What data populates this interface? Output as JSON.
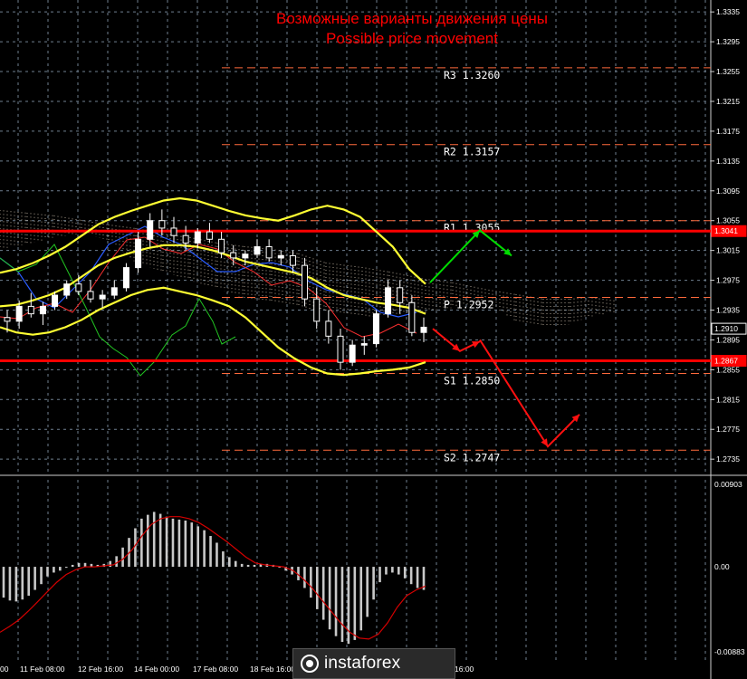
{
  "title_ru": "Возможные варианты движения цены",
  "title_en": "Possible price movement",
  "colors": {
    "background": "#000000",
    "grid": "#6f7f8f",
    "title": "#ff0000",
    "pivot_lines": "#ff6a3c",
    "support_resistance": "#ff0000",
    "bollinger": "#ffff33",
    "candles": "#ffffff",
    "arrow_up": "#00dd00",
    "arrow_down": "#ff1010",
    "macd_hist": "#c8c8c8",
    "macd_signal": "#d40000"
  },
  "chart_data": {
    "type": "candlestick",
    "symbol_direction_note": "",
    "y_axis": {
      "ylim": [
        1.2717,
        1.3351
      ],
      "ticks": [
        "1.3335",
        "1.3295",
        "1.3255",
        "1.3215",
        "1.3175",
        "1.3135",
        "1.3095",
        "1.3055",
        "1.3015",
        "1.2975",
        "1.2935",
        "1.2895",
        "1.2855",
        "1.2815",
        "1.2775",
        "1.2735"
      ],
      "price_labels": [
        {
          "value": 1.3041,
          "text": "1.3041"
        },
        {
          "value": 1.291,
          "text": "1.2910"
        },
        {
          "value": 1.2867,
          "text": "1.2867"
        }
      ]
    },
    "x_axis": {
      "ticks": [
        "00",
        "11 Feb 08:00",
        "12 Feb 16:00",
        "14 Feb 00:00",
        "17 Feb 08:00",
        "18 Feb 16:00",
        "16:00"
      ]
    },
    "pivot_levels": [
      {
        "label": "R3",
        "value": "1.3260"
      },
      {
        "label": "R2",
        "value": "1.3157"
      },
      {
        "label": "R1",
        "value": "1.3055"
      },
      {
        "label": "P",
        "value": "1.2952"
      },
      {
        "label": "S1",
        "value": "1.2850"
      },
      {
        "label": "S2",
        "value": "1.2747"
      }
    ],
    "horizontal_levels": [
      1.3041,
      1.2867
    ],
    "candles_ohlc": [
      [
        1.2925,
        1.2935,
        1.2905,
        1.292
      ],
      [
        1.292,
        1.2948,
        1.291,
        1.294
      ],
      [
        1.294,
        1.2958,
        1.2925,
        1.293
      ],
      [
        1.293,
        1.2946,
        1.2915,
        1.294
      ],
      [
        1.294,
        1.296,
        1.2935,
        1.2955
      ],
      [
        1.2955,
        1.2975,
        1.295,
        1.297
      ],
      [
        1.297,
        1.2982,
        1.2955,
        1.296
      ],
      [
        1.296,
        1.2975,
        1.2945,
        1.295
      ],
      [
        1.295,
        1.2962,
        1.2938,
        1.2955
      ],
      [
        1.2955,
        1.2975,
        1.295,
        1.2965
      ],
      [
        1.2965,
        1.2998,
        1.296,
        1.2992
      ],
      [
        1.2992,
        1.304,
        1.2985,
        1.303
      ],
      [
        1.303,
        1.3065,
        1.302,
        1.3055
      ],
      [
        1.3055,
        1.307,
        1.3035,
        1.3045
      ],
      [
        1.3045,
        1.306,
        1.3025,
        1.3035
      ],
      [
        1.3035,
        1.3048,
        1.3015,
        1.3025
      ],
      [
        1.3025,
        1.3045,
        1.3018,
        1.304
      ],
      [
        1.304,
        1.3052,
        1.3025,
        1.303
      ],
      [
        1.303,
        1.304,
        1.3005,
        1.3012
      ],
      [
        1.3012,
        1.3022,
        1.2995,
        1.3005
      ],
      [
        1.3005,
        1.3015,
        1.2995,
        1.301
      ],
      [
        1.301,
        1.303,
        1.3005,
        1.302
      ],
      [
        1.302,
        1.303,
        1.3,
        1.3005
      ],
      [
        1.3005,
        1.3015,
        1.2995,
        1.3008
      ],
      [
        1.3008,
        1.3015,
        1.2985,
        1.2995
      ],
      [
        1.2995,
        1.3005,
        1.294,
        1.295
      ],
      [
        1.295,
        1.2965,
        1.291,
        1.292
      ],
      [
        1.292,
        1.2935,
        1.289,
        1.29
      ],
      [
        1.29,
        1.291,
        1.2855,
        1.2865
      ],
      [
        1.2865,
        1.2895,
        1.286,
        1.2888
      ],
      [
        1.2888,
        1.29,
        1.2875,
        1.289
      ],
      [
        1.289,
        1.2935,
        1.2885,
        1.293
      ],
      [
        1.293,
        1.2975,
        1.2925,
        1.2965
      ],
      [
        1.2965,
        1.2975,
        1.293,
        1.2945
      ],
      [
        1.2945,
        1.2955,
        1.29,
        1.2905
      ],
      [
        1.2905,
        1.2925,
        1.2892,
        1.2912
      ]
    ],
    "bollinger": {
      "upper": [
        1.2985,
        1.299,
        1.2998,
        1.3008,
        1.302,
        1.3035,
        1.305,
        1.306,
        1.3068,
        1.3075,
        1.3082,
        1.3085,
        1.3082,
        1.3075,
        1.3068,
        1.3062,
        1.3058,
        1.3055,
        1.3062,
        1.307,
        1.3075,
        1.307,
        1.306,
        1.304,
        1.302,
        1.299,
        1.297
      ],
      "middle": [
        1.294,
        1.2942,
        1.2948,
        1.2955,
        1.2965,
        1.298,
        1.2995,
        1.3005,
        1.3012,
        1.3018,
        1.3022,
        1.3022,
        1.302,
        1.3015,
        1.3008,
        1.3,
        1.2995,
        1.299,
        1.2985,
        1.2978,
        1.2965,
        1.2955,
        1.295,
        1.2945,
        1.2942,
        1.2938,
        1.293
      ],
      "lower": [
        1.2912,
        1.2905,
        1.2902,
        1.2905,
        1.2912,
        1.2922,
        1.2935,
        1.2945,
        1.2955,
        1.2962,
        1.2965,
        1.296,
        1.2955,
        1.2948,
        1.294,
        1.2925,
        1.2905,
        1.2885,
        1.287,
        1.2858,
        1.285,
        1.2848,
        1.285,
        1.2853,
        1.2855,
        1.2858,
        1.2865
      ]
    },
    "forecast_arrows": [
      {
        "direction": "up",
        "path": [
          [
            1.2972
          ],
          [
            1.3042
          ],
          [
            1.3008
          ]
        ]
      },
      {
        "direction": "down",
        "path": [
          [
            1.291
          ],
          [
            1.288
          ],
          [
            1.2893
          ]
        ]
      },
      {
        "direction": "down",
        "path": [
          [
            1.2895
          ],
          [
            1.2752
          ],
          [
            1.2795
          ]
        ]
      }
    ],
    "macd": {
      "ylim_labels": [
        "0.00903",
        "0.00",
        "-0.00883"
      ],
      "histogram": [
        -0.0032,
        -0.0035,
        -0.0036,
        -0.0034,
        -0.003,
        -0.0024,
        -0.0018,
        -0.001,
        -0.0006,
        -0.0004,
        -0.0001,
        0.0002,
        0.0004,
        0.0004,
        0.0003,
        0.0002,
        0.0003,
        0.0006,
        0.0011,
        0.002,
        0.003,
        0.004,
        0.005,
        0.0054,
        0.0057,
        0.0055,
        0.0052,
        0.005,
        0.0049,
        0.0048,
        0.0046,
        0.0042,
        0.0038,
        0.0032,
        0.0025,
        0.0016,
        0.001,
        0.0006,
        0.0003,
        0.0002,
        0.0002,
        0.0003,
        0.0003,
        0.0002,
        0.0,
        -0.0004,
        -0.0008,
        -0.0014,
        -0.0022,
        -0.0032,
        -0.0044,
        -0.0055,
        -0.0065,
        -0.0072,
        -0.0078,
        -0.008,
        -0.0076,
        -0.0066,
        -0.0052,
        -0.0034,
        -0.0016,
        -0.0008,
        -0.0006,
        -0.0008,
        -0.0012,
        -0.0018,
        -0.0022,
        -0.0024
      ],
      "signal": [
        -0.0068,
        -0.0062,
        -0.0055,
        -0.0046,
        -0.0036,
        -0.0026,
        -0.0016,
        -0.0008,
        -0.0003,
        0.0,
        0.0,
        0.0001,
        0.0002,
        0.0008,
        0.0018,
        0.0032,
        0.0044,
        0.005,
        0.0052,
        0.0052,
        0.005,
        0.0046,
        0.004,
        0.0033,
        0.0026,
        0.0018,
        0.001,
        0.0004,
        0.0002,
        0.0001,
        0.0,
        -0.0004,
        -0.0012,
        -0.0022,
        -0.0034,
        -0.0046,
        -0.0058,
        -0.0068,
        -0.0074,
        -0.0075,
        -0.007,
        -0.0058,
        -0.0042,
        -0.003,
        -0.0024,
        -0.002
      ]
    }
  },
  "watermark": "instaforex"
}
